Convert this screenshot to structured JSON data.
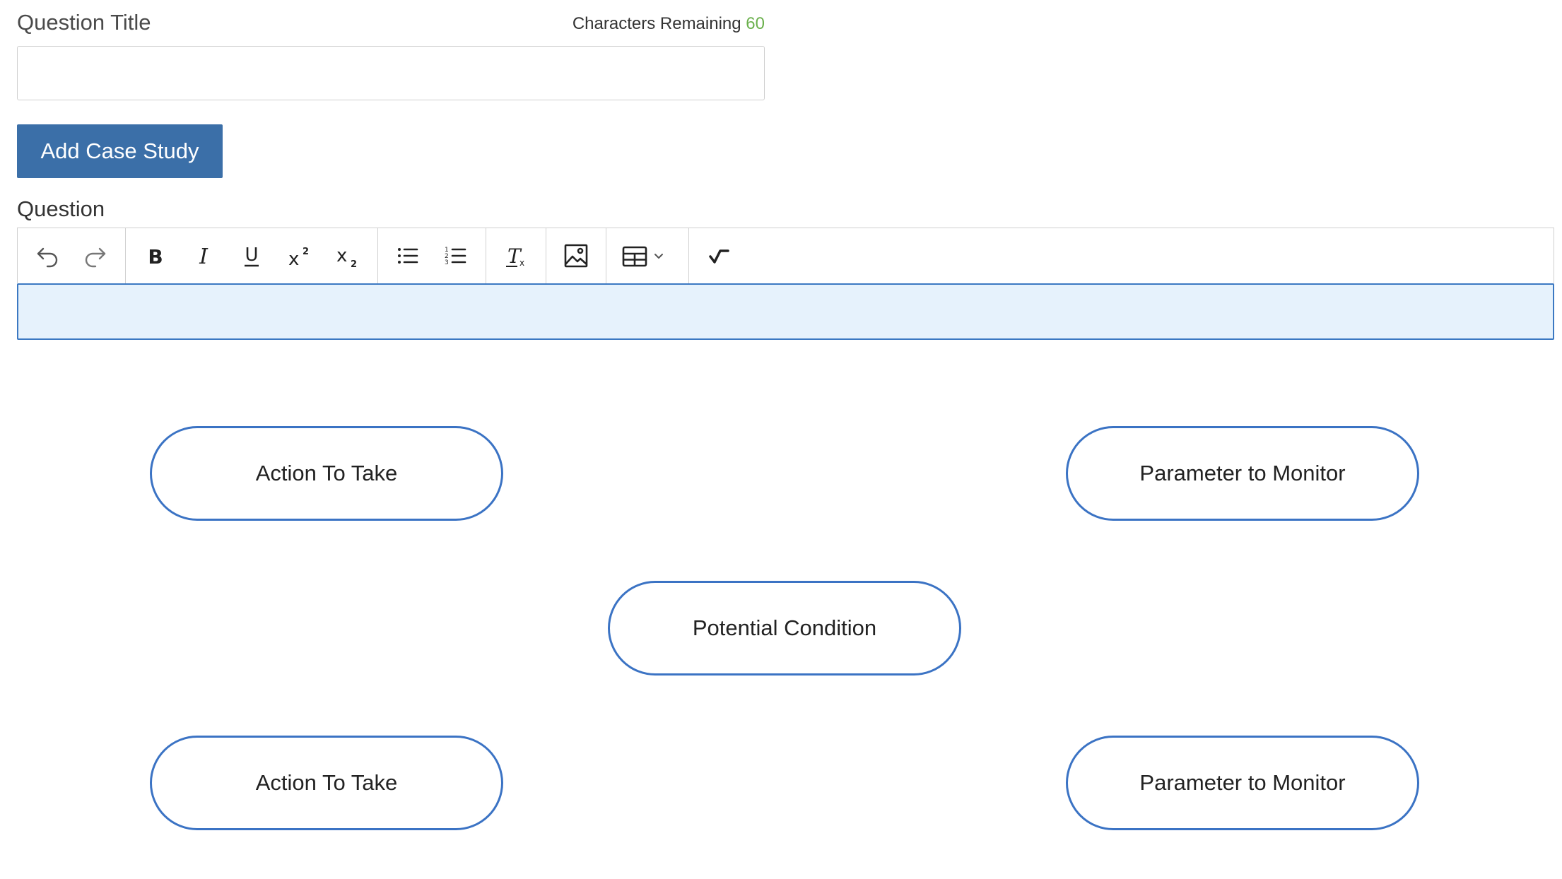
{
  "form": {
    "title_label": "Question Title",
    "chars_remaining_label": "Characters Remaining",
    "chars_remaining_value": "60",
    "title_value": "",
    "add_case_study_label": "Add Case Study",
    "question_label": "Question"
  },
  "toolbar": {
    "icons": [
      "undo-icon",
      "redo-icon",
      "bold-icon",
      "italic-icon",
      "underline-icon",
      "superscript-icon",
      "subscript-icon",
      "bullet-list-icon",
      "numbered-list-icon",
      "clear-format-icon",
      "image-icon",
      "table-icon",
      "math-icon"
    ]
  },
  "diagram": {
    "nodes": [
      {
        "label": "Action To Take"
      },
      {
        "label": "Parameter to Monitor"
      },
      {
        "label": "Potential Condition"
      },
      {
        "label": "Action To Take"
      },
      {
        "label": "Parameter to Monitor"
      }
    ]
  },
  "colors": {
    "accent": "#3b6fa8",
    "pill_border": "#3b73c4",
    "editor_bg": "#e6f2fc",
    "count_green": "#6ab04c"
  }
}
